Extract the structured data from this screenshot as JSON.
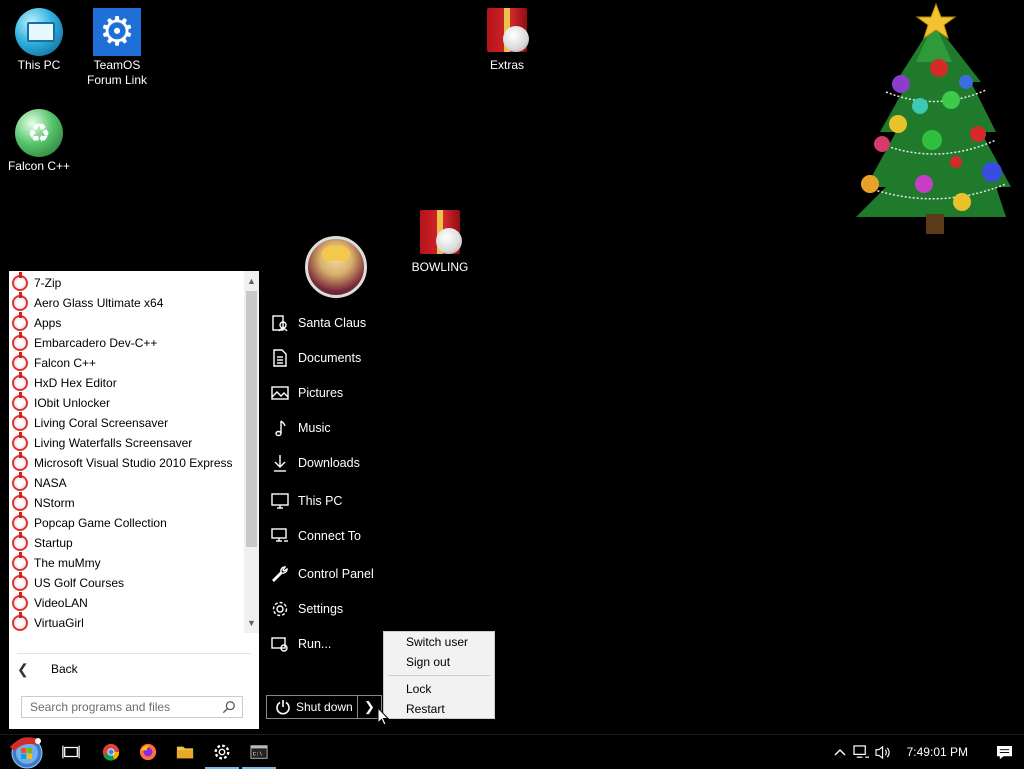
{
  "desktop": {
    "icons": [
      {
        "label": "This PC",
        "icon": "this-pc-icon"
      },
      {
        "label": "TeamOS\nForum Link",
        "icon": "settings-gear-icon"
      },
      {
        "label": "Extras",
        "icon": "gift-icon"
      },
      {
        "label": "Falcon C++",
        "icon": "recycle-icon"
      },
      {
        "label": "BOWLING",
        "icon": "gift-icon"
      }
    ],
    "wallpaper_color": "#000000"
  },
  "start_menu": {
    "programs": [
      "7-Zip",
      "Aero Glass Ultimate x64",
      "Apps",
      "Embarcadero Dev-C++",
      "Falcon C++",
      "HxD Hex Editor",
      "IObit Unlocker",
      "Living Coral Screensaver",
      "Living Waterfalls Screensaver",
      "Microsoft Visual Studio 2010 Express",
      "NASA",
      "NStorm",
      "Popcap Game Collection",
      "Startup",
      "The muMmy",
      "US Golf Courses",
      "VideoLAN",
      "VirtuaGirl"
    ],
    "back_label": "Back",
    "search_placeholder": "Search programs and files",
    "right_column": [
      {
        "label": "Santa Claus",
        "icon": "user-folder-icon"
      },
      {
        "label": "Documents",
        "icon": "document-icon"
      },
      {
        "label": "Pictures",
        "icon": "picture-icon"
      },
      {
        "label": "Music",
        "icon": "music-note-icon"
      },
      {
        "label": "Downloads",
        "icon": "download-icon"
      },
      {
        "label": "This PC",
        "icon": "monitor-icon"
      },
      {
        "label": "Connect To",
        "icon": "network-icon"
      },
      {
        "label": "Control Panel",
        "icon": "wrench-icon"
      },
      {
        "label": "Settings",
        "icon": "gear-icon"
      },
      {
        "label": "Run...",
        "icon": "run-icon"
      }
    ],
    "shutdown_label": "Shut down",
    "shutdown_menu": [
      "Switch user",
      "Sign out",
      "Lock",
      "Restart"
    ]
  },
  "taskbar": {
    "apps": [
      "task-view-icon",
      "chrome-icon",
      "firefox-icon",
      "file-explorer-icon",
      "settings-icon",
      "command-prompt-icon"
    ],
    "clock": "7:49:01 PM",
    "accent_color": "#76b9ed"
  }
}
